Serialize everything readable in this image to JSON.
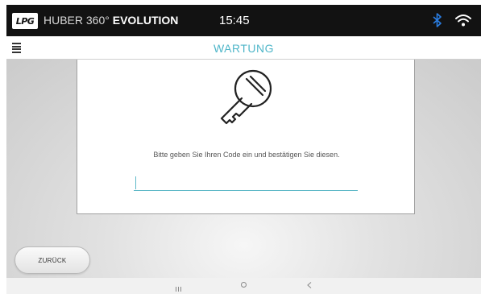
{
  "status_bar": {
    "logo": "LPG",
    "brand_light": "HUBER 360°",
    "brand_bold": "EVOLUTION",
    "time": "15:45",
    "icons": [
      "bluetooth-icon",
      "wifi-icon"
    ],
    "bluetooth_color": "#2a7de1"
  },
  "title_bar": {
    "menu_icon": "hamburger-menu-icon",
    "title": "WARTUNG",
    "title_color": "#4fb6c9"
  },
  "dialog": {
    "icon": "key-icon",
    "prompt": "Bitte geben Sie Ihren Code ein und bestätigen Sie diesen.",
    "code_value": "",
    "accent_color": "#5fb9c8"
  },
  "footer": {
    "back_label": "ZURÜCK"
  },
  "nav_bar": {
    "icons": [
      "recents-icon",
      "home-icon",
      "back-icon"
    ]
  }
}
